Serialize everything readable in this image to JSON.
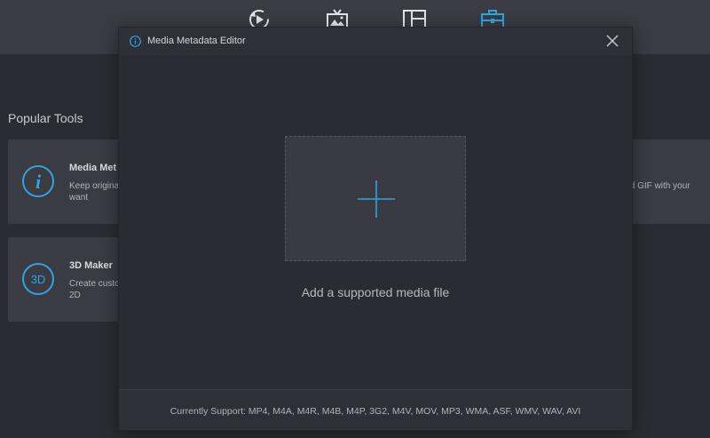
{
  "topbar": {
    "tabs": [
      {
        "name": "converter",
        "icon": "convert-icon"
      },
      {
        "name": "mv",
        "icon": "mv-icon"
      },
      {
        "name": "collage",
        "icon": "collage-icon"
      },
      {
        "name": "toolbox",
        "icon": "toolbox-icon",
        "active": true
      }
    ]
  },
  "popular": {
    "title": "Popular Tools",
    "tools": [
      {
        "name": "Media Met",
        "desc": "Keep origina want",
        "desc_line1": "Keep origina",
        "desc_line2": "want",
        "icon": "info-circle-icon"
      },
      {
        "name": "3D Maker",
        "desc_line1": "Create custo",
        "desc_line2": "2D",
        "icon": "3d-icon"
      }
    ],
    "right_card_text": "ized GIF with your"
  },
  "modal": {
    "title": "Media Metadata Editor",
    "drop_label": "Add a supported media file",
    "support_text": "Currently Support: MP4, M4A, M4R, M4B, M4P, 3G2, M4V, MOV, MP3, WMA, ASF, WMV, WAV, AVI"
  },
  "colors": {
    "accent": "#2fa5e0",
    "background": "#2b2c33",
    "panel": "#3a3b43"
  }
}
